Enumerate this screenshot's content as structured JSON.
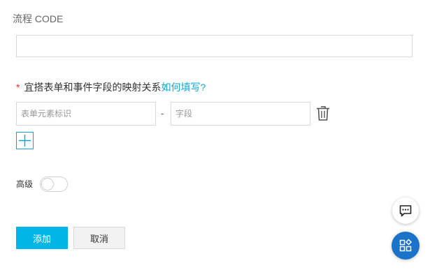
{
  "flow_code": {
    "label": "流程 CODE",
    "value": ""
  },
  "mapping": {
    "required_mark": "*",
    "label": "宜搭表单和事件字段的映射关系",
    "help_link": "如何填写?",
    "form_field_placeholder": "表单元素标识",
    "separator": "-",
    "event_field_placeholder": "字段",
    "delete_icon": "trash-icon",
    "add_icon": "plus-icon"
  },
  "advanced": {
    "label": "高级",
    "enabled": false
  },
  "actions": {
    "add_label": "添加",
    "cancel_label": "取消"
  },
  "floating": {
    "chat_icon": "chat-bubble-icon",
    "apps_icon": "apps-grid-icon"
  },
  "colors": {
    "accent": "#00b6e6",
    "link": "#0aa6d6",
    "required": "#e5322d",
    "fab_primary": "#1a73c8"
  }
}
